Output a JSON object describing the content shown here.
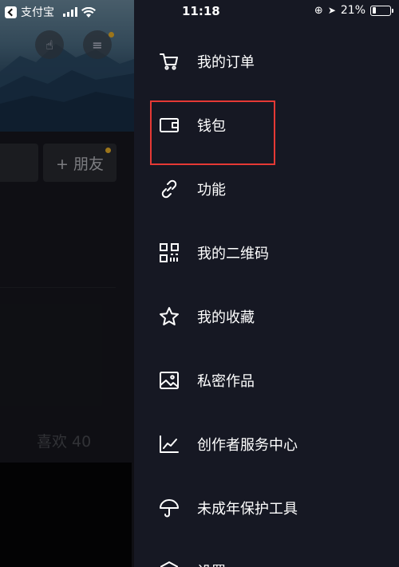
{
  "status_bar": {
    "back_app": "支付宝",
    "time": "11:18",
    "battery": "21%",
    "battery_level": 0.21
  },
  "background": {
    "add_friend": "+ 朋友",
    "likes": "喜欢 40"
  },
  "menu": {
    "items": [
      {
        "label": "我的订单",
        "icon": "cart-icon"
      },
      {
        "label": "钱包",
        "icon": "wallet-icon"
      },
      {
        "label": "功能",
        "icon": "link-icon"
      },
      {
        "label": "我的二维码",
        "icon": "qr-code-icon"
      },
      {
        "label": "我的收藏",
        "icon": "star-icon"
      },
      {
        "label": "私密作品",
        "icon": "image-icon"
      },
      {
        "label": "创作者服务中心",
        "icon": "chart-icon"
      },
      {
        "label": "未成年保护工具",
        "icon": "umbrella-icon"
      },
      {
        "label": "设置",
        "icon": "settings-icon"
      }
    ]
  },
  "colors": {
    "drawer_bg": "#161823",
    "highlight": "#e53935",
    "notification_dot": "#f0b429"
  }
}
